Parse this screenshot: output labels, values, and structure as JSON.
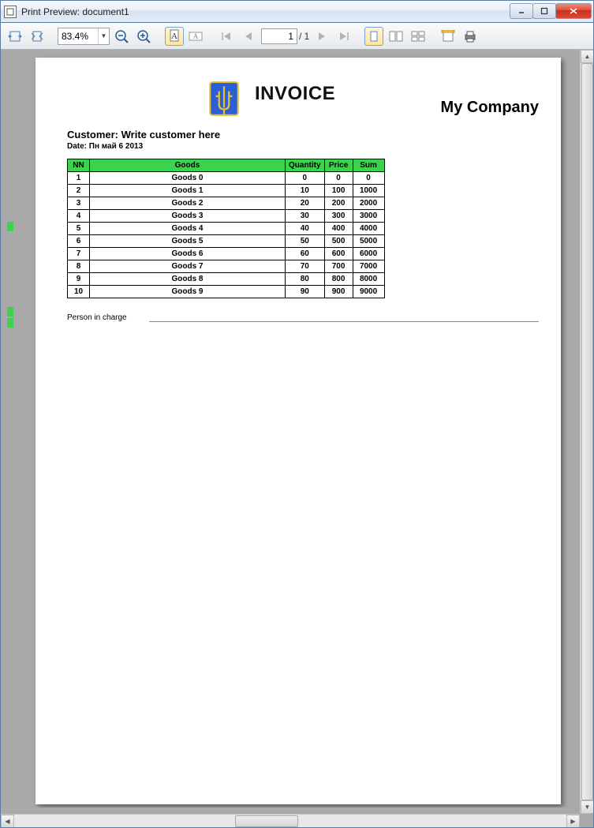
{
  "window": {
    "title": "Print Preview: document1"
  },
  "toolbar": {
    "zoom_value": "83.4%",
    "page_current": "1",
    "page_sep": "/ 1"
  },
  "document": {
    "title": "INVOICE",
    "company": "My Company",
    "customer_label": "Customer: Write customer here",
    "date_label": "Date: Пн май 6 2013",
    "headers": {
      "nn": "NN",
      "goods": "Goods",
      "qty": "Quantity",
      "price": "Price",
      "sum": "Sum"
    },
    "rows": [
      {
        "nn": "1",
        "goods": "Goods 0",
        "qty": "0",
        "price": "0",
        "sum": "0"
      },
      {
        "nn": "2",
        "goods": "Goods 1",
        "qty": "10",
        "price": "100",
        "sum": "1000"
      },
      {
        "nn": "3",
        "goods": "Goods 2",
        "qty": "20",
        "price": "200",
        "sum": "2000"
      },
      {
        "nn": "4",
        "goods": "Goods 3",
        "qty": "30",
        "price": "300",
        "sum": "3000"
      },
      {
        "nn": "5",
        "goods": "Goods 4",
        "qty": "40",
        "price": "400",
        "sum": "4000"
      },
      {
        "nn": "6",
        "goods": "Goods 5",
        "qty": "50",
        "price": "500",
        "sum": "5000"
      },
      {
        "nn": "7",
        "goods": "Goods 6",
        "qty": "60",
        "price": "600",
        "sum": "6000"
      },
      {
        "nn": "8",
        "goods": "Goods 7",
        "qty": "70",
        "price": "700",
        "sum": "7000"
      },
      {
        "nn": "9",
        "goods": "Goods 8",
        "qty": "80",
        "price": "800",
        "sum": "8000"
      },
      {
        "nn": "10",
        "goods": "Goods 9",
        "qty": "90",
        "price": "900",
        "sum": "9000"
      }
    ],
    "signature_label": "Person in charge"
  }
}
